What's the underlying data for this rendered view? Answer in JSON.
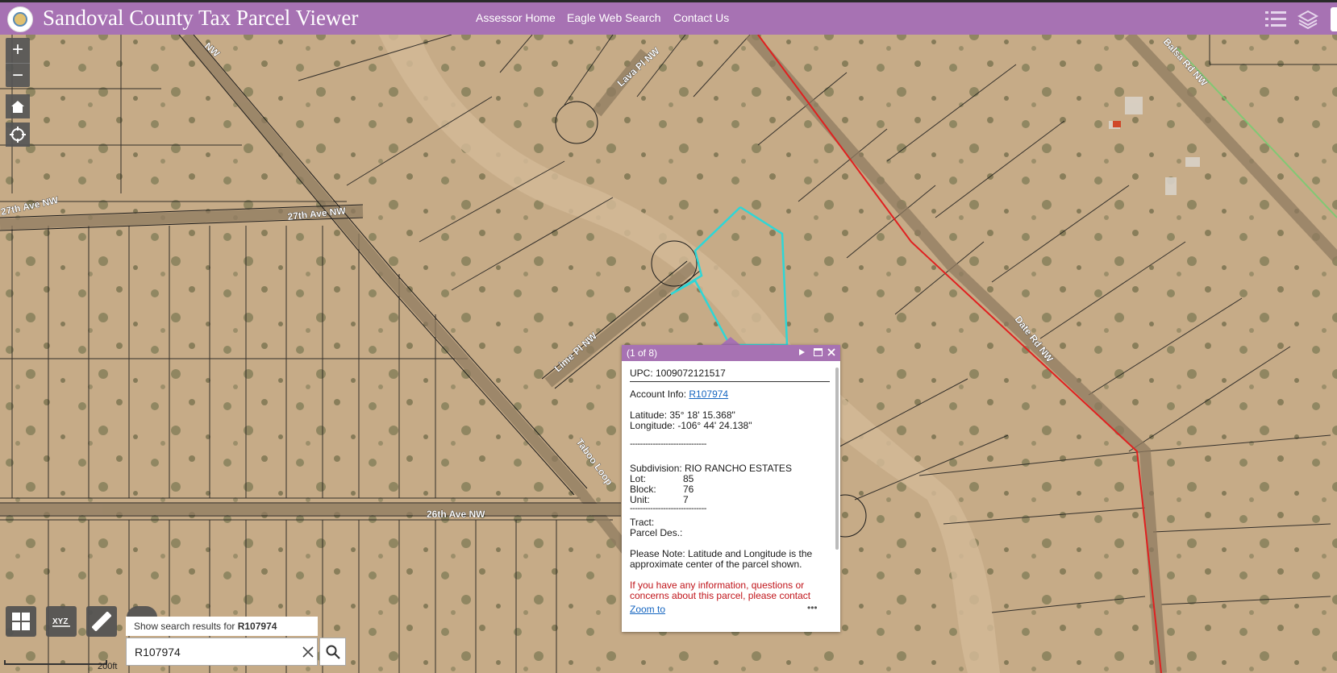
{
  "header": {
    "title": "Sandoval County Tax Parcel Viewer",
    "nav": [
      "Assessor Home",
      "Eagle Web Search",
      "Contact Us"
    ],
    "bg_color": "#a772b3"
  },
  "map": {
    "road_labels": [
      "Lava Pl NW",
      "27th Ave NW",
      "27th Ave NW",
      "Lime Pl NW",
      "Taboo Loop",
      "26th Ave NW",
      "Date Rd NW",
      "Balsa Rd NW",
      "NW"
    ],
    "selected_parcel_color": "#2fd6d6",
    "highlight_road_color": "#e02020",
    "scale_label": "200ft",
    "controls": [
      "zoom-in",
      "zoom-out",
      "home",
      "locate"
    ]
  },
  "popup": {
    "count": "(1 of 8)",
    "upc": "UPC: 1009072121517",
    "account_label": "Account Info: ",
    "account_link": "R107974",
    "latitude": "Latitude: 35° 18' 15.368\"",
    "longitude": "Longitude: -106° 44' 24.138\"",
    "divider": "------------------------------",
    "subdivision": "Subdivision: RIO RANCHO ESTATES",
    "lot_label": "Lot:",
    "lot_value": "85",
    "block_label": "Block:",
    "block_value": "76",
    "unit_label": "Unit:",
    "unit_value": "7",
    "tract_label": "Tract:",
    "parcel_des_label": "Parcel Des.:",
    "note_line1": "Please Note: Latitude and Longitude is the",
    "note_line2": "approximate center of the parcel shown.",
    "warn_line1": "If you have any information, questions or",
    "warn_line2": "concerns about this parcel, please contact",
    "zoom_to": "Zoom to",
    "more": "•••"
  },
  "search": {
    "hint_prefix": "Show search results for ",
    "hint_term": "R107974",
    "value": "R107974"
  }
}
